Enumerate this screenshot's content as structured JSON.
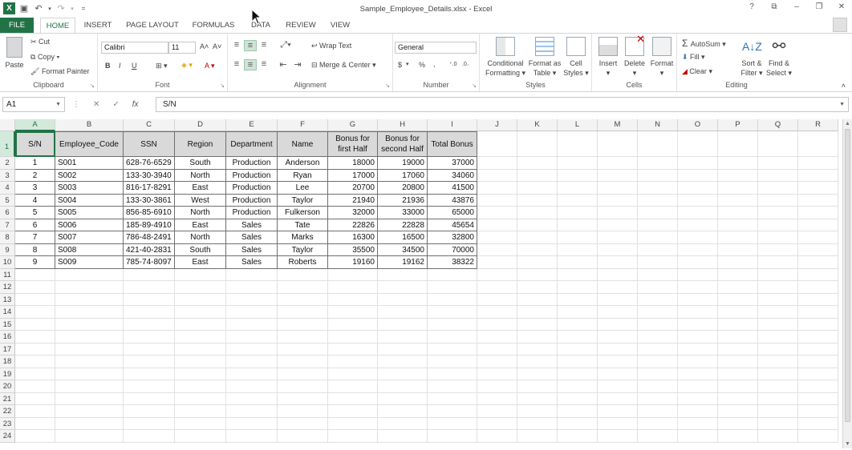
{
  "window": {
    "title": "Sample_Employee_Details.xlsx - Excel",
    "controls": [
      "?",
      "⧉",
      "–",
      "❐",
      "✕"
    ]
  },
  "tabs": [
    "FILE",
    "HOME",
    "INSERT",
    "PAGE LAYOUT",
    "FORMULAS",
    "DATA",
    "REVIEW",
    "VIEW"
  ],
  "active_tab": "HOME",
  "ribbon": {
    "clipboard": {
      "label": "Clipboard",
      "paste": "Paste",
      "cut": "Cut",
      "copy": "Copy",
      "format_painter": "Format Painter"
    },
    "font": {
      "label": "Font",
      "name": "Calibri",
      "size": "11",
      "bold": "B",
      "italic": "I",
      "underline": "U",
      "grow": "A˄",
      "shrink": "A˅"
    },
    "alignment": {
      "label": "Alignment",
      "wrap_text": "Wrap Text",
      "merge_center": "Merge & Center"
    },
    "number": {
      "label": "Number",
      "format": "General",
      "currency": "$",
      "percent": "%",
      "comma": ","
    },
    "styles": {
      "label": "Styles",
      "conditional": "Conditional",
      "conditional2": "Formatting",
      "format_as": "Format as",
      "format_as2": "Table",
      "cell_styles": "Cell",
      "cell_styles2": "Styles"
    },
    "cells": {
      "label": "Cells",
      "insert": "Insert",
      "delete": "Delete",
      "format": "Format"
    },
    "editing": {
      "label": "Editing",
      "autosum": "AutoSum",
      "fill": "Fill",
      "clear": "Clear",
      "sort": "Sort &",
      "sort2": "Filter",
      "find": "Find &",
      "find2": "Select"
    }
  },
  "formula_bar": {
    "name_box": "A1",
    "fx": "fx",
    "content": "S/N"
  },
  "grid": {
    "columns": [
      "A",
      "B",
      "C",
      "D",
      "E",
      "F",
      "G",
      "H",
      "I",
      "J",
      "K",
      "L",
      "M",
      "N",
      "O",
      "P",
      "Q",
      "R"
    ],
    "row_numbers": [
      "1",
      "2",
      "3",
      "4",
      "5",
      "6",
      "7",
      "8",
      "9",
      "10",
      "11",
      "12",
      "13",
      "14",
      "15",
      "16",
      "17",
      "18",
      "19",
      "20",
      "21",
      "22",
      "23",
      "24"
    ],
    "headers": [
      "S/N",
      "Employee_Code",
      "SSN",
      "Region",
      "Department",
      "Name",
      "Bonus for first Half",
      "Bonus for second Half",
      "Total Bonus"
    ],
    "rows": [
      [
        "1",
        "S001",
        "628-76-6529",
        "South",
        "Production",
        "Anderson",
        "18000",
        "19000",
        "37000"
      ],
      [
        "2",
        "S002",
        "133-30-3940",
        "North",
        "Production",
        "Ryan",
        "17000",
        "17060",
        "34060"
      ],
      [
        "3",
        "S003",
        "816-17-8291",
        "East",
        "Production",
        "Lee",
        "20700",
        "20800",
        "41500"
      ],
      [
        "4",
        "S004",
        "133-30-3861",
        "West",
        "Production",
        "Taylor",
        "21940",
        "21936",
        "43876"
      ],
      [
        "5",
        "S005",
        "856-85-6910",
        "North",
        "Production",
        "Fulkerson",
        "32000",
        "33000",
        "65000"
      ],
      [
        "6",
        "S006",
        "185-89-4910",
        "East",
        "Sales",
        "Tate",
        "22826",
        "22828",
        "45654"
      ],
      [
        "7",
        "S007",
        "786-48-2491",
        "North",
        "Sales",
        "Marks",
        "16300",
        "16500",
        "32800"
      ],
      [
        "8",
        "S008",
        "421-40-2831",
        "South",
        "Sales",
        "Taylor",
        "35500",
        "34500",
        "70000"
      ],
      [
        "9",
        "S009",
        "785-74-8097",
        "East",
        "Sales",
        "Roberts",
        "19160",
        "19162",
        "38322"
      ]
    ]
  }
}
